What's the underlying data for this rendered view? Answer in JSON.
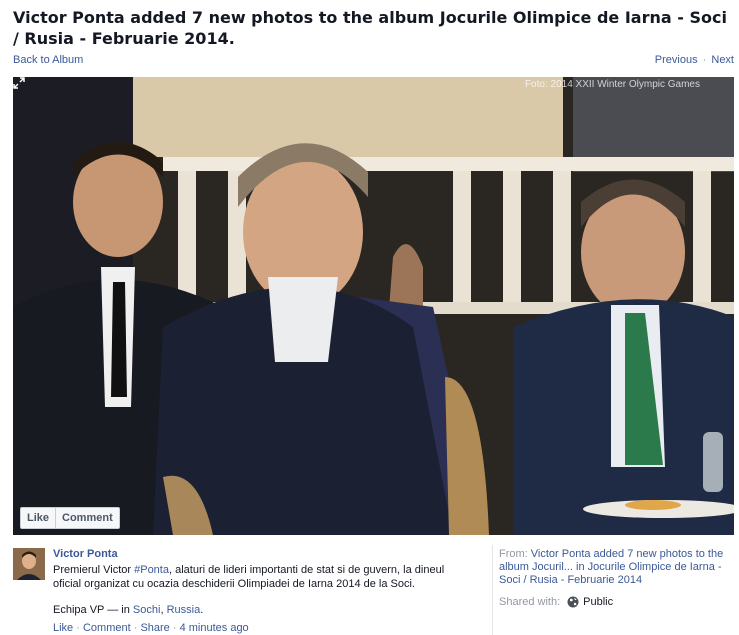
{
  "header": {
    "title": "Victor Ponta added 7 new photos to the album Jocurile Olimpice de Iarna - Soci / Rusia - Februarie 2014.",
    "back_link": "Back to Album",
    "previous": "Previous",
    "separator": "·",
    "next": "Next"
  },
  "photo": {
    "watermark": "Foto: 2014 XXII Winter Olympic Games",
    "expand_icon": "expand-icon",
    "like_label": "Like",
    "comment_label": "Comment"
  },
  "post": {
    "author": "Victor Ponta",
    "caption_before": "Premierul Victor ",
    "hashtag": "#Ponta",
    "caption_after": ", alaturi de lideri importanti de stat si de guvern, la dineul oficial organizat cu ocazia deschiderii Olimpiadei de Iarna 2014 de la Soci.",
    "signoff": "Echipa VP",
    "location_prefix": " — in ",
    "location_city": "Sochi",
    "location_comma": ", ",
    "location_country": "Russia",
    "location_end": ".",
    "actions": {
      "like": "Like",
      "comment": "Comment",
      "share": "Share",
      "dot": " · ",
      "time": "4 minutes ago"
    }
  },
  "sidebar": {
    "from_label": "From: ",
    "from_text": "Victor Ponta added 7 new photos to the album Jocuril... in Jocurile Olimpice de Iarna - Soci / Rusia - Februarie 2014",
    "shared_label": "Shared with:",
    "audience": "Public",
    "audience_icon": "globe-icon"
  },
  "colors": {
    "link": "#3b5998",
    "muted": "#9197a3",
    "text": "#141823"
  }
}
